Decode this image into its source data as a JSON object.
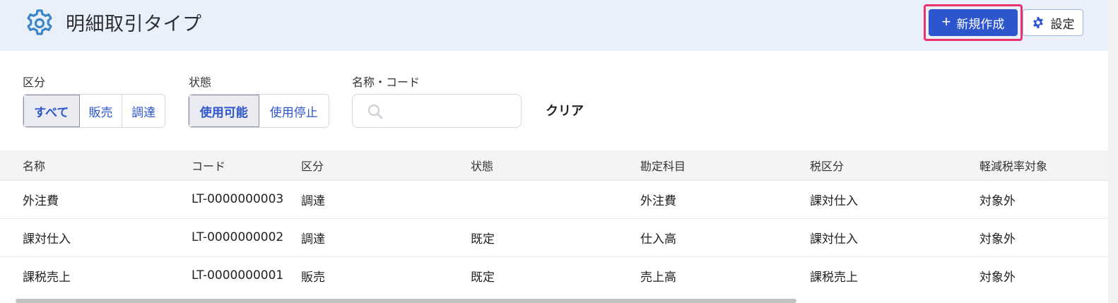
{
  "header": {
    "title": "明細取引タイプ",
    "new_button": "新規作成",
    "settings_button": "設定"
  },
  "filters": {
    "category": {
      "label": "区分",
      "options": [
        "すべて",
        "販売",
        "調達"
      ],
      "selected": "すべて"
    },
    "status": {
      "label": "状態",
      "options": [
        "使用可能",
        "使用停止"
      ],
      "selected": "使用可能"
    },
    "search": {
      "label": "名称・コード",
      "value": "",
      "placeholder": ""
    },
    "clear": "クリア"
  },
  "table": {
    "columns": [
      "名称",
      "コード",
      "区分",
      "状態",
      "勘定科目",
      "税区分",
      "軽減税率対象"
    ],
    "rows": [
      [
        "外注費",
        "LT-0000000003",
        "調達",
        "",
        "外注費",
        "課対仕入",
        "対象外"
      ],
      [
        "課対仕入",
        "LT-0000000002",
        "調達",
        "既定",
        "仕入高",
        "課対仕入",
        "対象外"
      ],
      [
        "課税売上",
        "LT-0000000001",
        "販売",
        "既定",
        "売上高",
        "課税売上",
        "対象外"
      ]
    ]
  },
  "colors": {
    "accent": "#2d55cc",
    "highlight": "#e8336e",
    "header_bg": "#eaf0fa",
    "icon_gear": "#3a86c8"
  }
}
